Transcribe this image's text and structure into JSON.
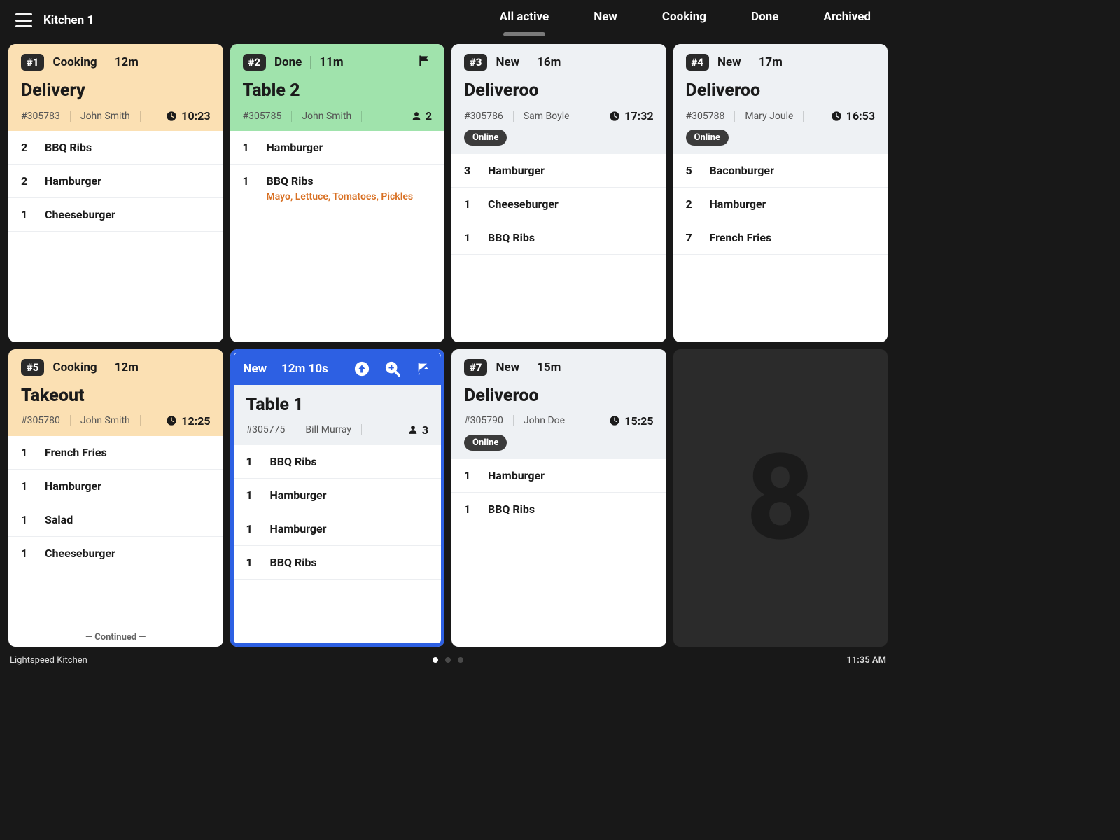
{
  "header": {
    "kitchen": "Kitchen 1",
    "tabs": [
      "All active",
      "New",
      "Cooking",
      "Done",
      "Archived"
    ],
    "active_tab": 0
  },
  "footer": {
    "brand": "Lightspeed Kitchen",
    "clock": "11:35 AM"
  },
  "ghost_slot": "8",
  "continued_label": "— Continued —",
  "online_label": "Online",
  "cards": [
    {
      "num": "#1",
      "status": "Cooking",
      "age": "12m",
      "title": "Delivery",
      "order_id": "#305783",
      "server": "John Smith",
      "time": "10:23",
      "header_style": "peach",
      "items": [
        {
          "qty": "2",
          "name": "BBQ Ribs"
        },
        {
          "qty": "2",
          "name": "Hamburger"
        },
        {
          "qty": "1",
          "name": "Cheeseburger"
        }
      ]
    },
    {
      "num": "#2",
      "status": "Done",
      "age": "11m",
      "title": "Table 2",
      "order_id": "#305785",
      "server": "John Smith",
      "guests": "2",
      "header_style": "green",
      "flagged": true,
      "items": [
        {
          "qty": "1",
          "name": "Hamburger"
        },
        {
          "qty": "1",
          "name": "BBQ Ribs",
          "mods": "Mayo, Lettuce, Tomatoes, Pickles"
        }
      ]
    },
    {
      "num": "#3",
      "status": "New",
      "age": "16m",
      "title": "Deliveroo",
      "order_id": "#305786",
      "server": "Sam Boyle",
      "time": "17:32",
      "online": true,
      "header_style": "grey",
      "items": [
        {
          "qty": "3",
          "name": "Hamburger"
        },
        {
          "qty": "1",
          "name": "Cheeseburger"
        },
        {
          "qty": "1",
          "name": "BBQ Ribs"
        }
      ]
    },
    {
      "num": "#4",
      "status": "New",
      "age": "17m",
      "title": "Deliveroo",
      "order_id": "#305788",
      "server": "Mary Joule",
      "time": "16:53",
      "online": true,
      "header_style": "grey",
      "items": [
        {
          "qty": "5",
          "name": "Baconburger"
        },
        {
          "qty": "2",
          "name": "Hamburger"
        },
        {
          "qty": "7",
          "name": "French Fries"
        }
      ]
    },
    {
      "num": "#5",
      "status": "Cooking",
      "age": "12m",
      "title": "Takeout",
      "order_id": "#305780",
      "server": "John Smith",
      "time": "12:25",
      "header_style": "peach",
      "continued": true,
      "items": [
        {
          "qty": "1",
          "name": "French Fries"
        },
        {
          "qty": "1",
          "name": "Hamburger"
        },
        {
          "qty": "1",
          "name": "Salad"
        },
        {
          "qty": "1",
          "name": "Cheeseburger"
        }
      ]
    },
    {
      "selected": true,
      "status": "New",
      "age": "12m 10s",
      "title": "Table 1",
      "order_id": "#305775",
      "server": "Bill Murray",
      "guests": "3",
      "header_style": "blue",
      "items": [
        {
          "qty": "1",
          "name": "BBQ Ribs"
        },
        {
          "qty": "1",
          "name": "Hamburger"
        },
        {
          "qty": "1",
          "name": "Hamburger"
        },
        {
          "qty": "1",
          "name": "BBQ Ribs"
        }
      ]
    },
    {
      "num": "#7",
      "status": "New",
      "age": "15m",
      "title": "Deliveroo",
      "order_id": "#305790",
      "server": "John Doe",
      "time": "15:25",
      "online": true,
      "header_style": "grey",
      "items": [
        {
          "qty": "1",
          "name": "Hamburger"
        },
        {
          "qty": "1",
          "name": "BBQ Ribs"
        }
      ]
    }
  ]
}
